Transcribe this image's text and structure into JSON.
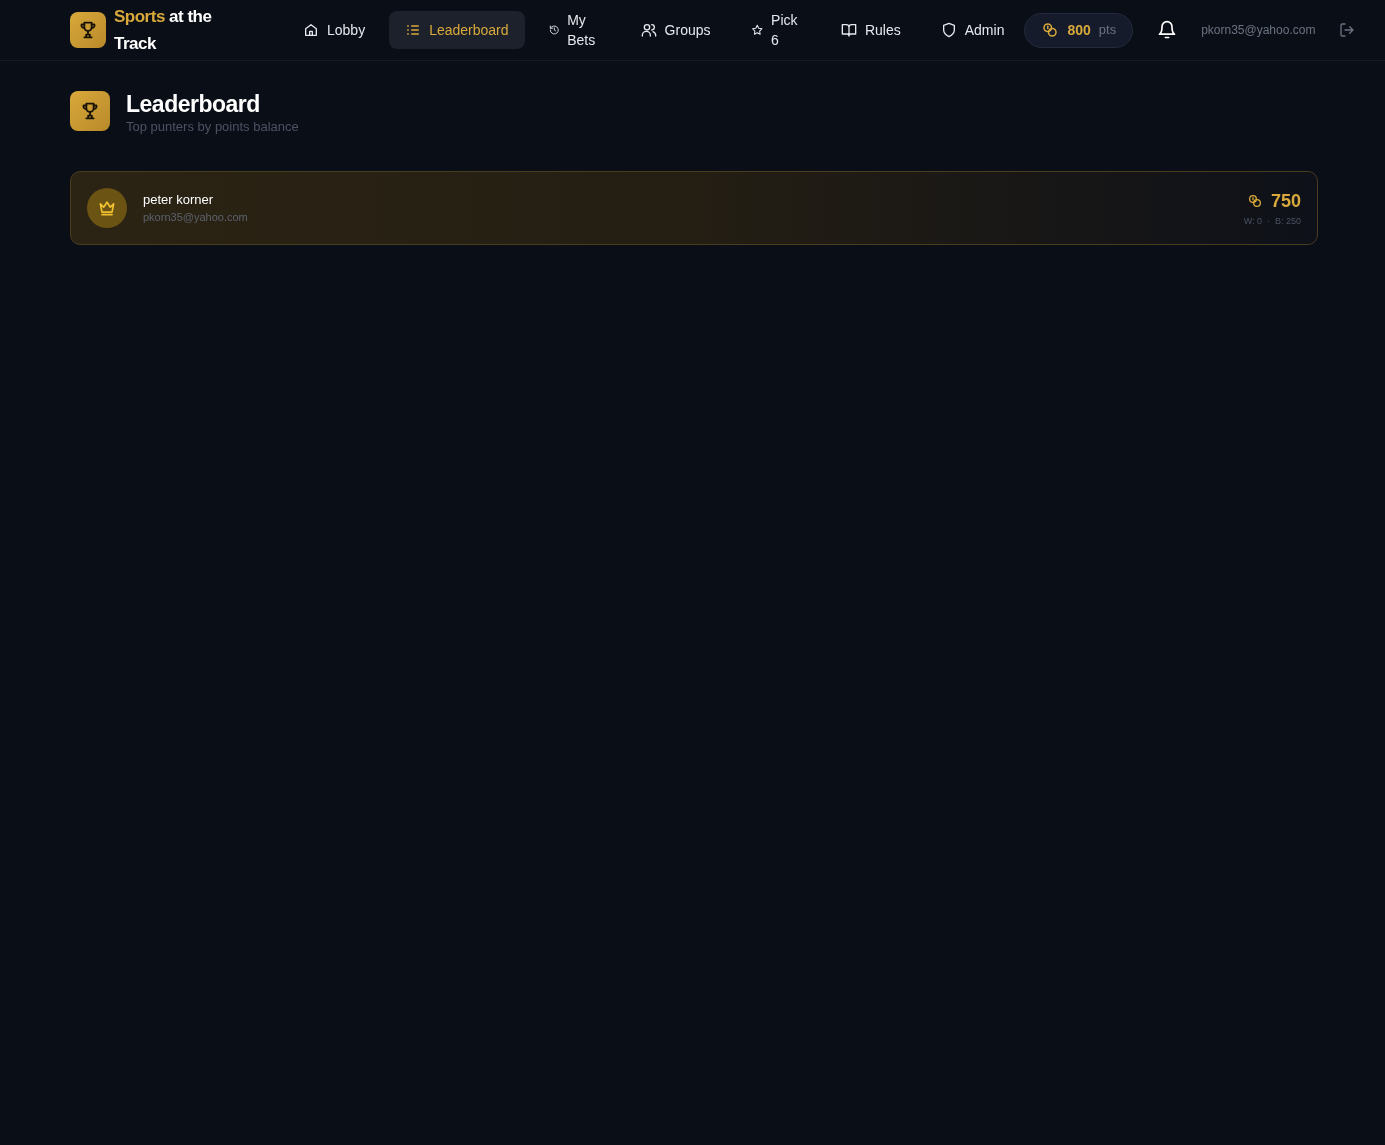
{
  "brand": {
    "accent": "Sports",
    "rest": "at the Track"
  },
  "nav": [
    {
      "label": "Lobby",
      "selected": false
    },
    {
      "label": "Leaderboard",
      "selected": true
    },
    {
      "label": "My Bets",
      "selected": false
    },
    {
      "label": "Groups",
      "selected": false
    },
    {
      "label": "Pick 6",
      "selected": false
    },
    {
      "label": "Rules",
      "selected": false
    },
    {
      "label": "Admin",
      "selected": false
    }
  ],
  "points": {
    "value": "800",
    "unit": "pts"
  },
  "user_email": "pkorn35@yahoo.com",
  "page": {
    "title": "Leaderboard",
    "subtitle": "Top punters by points balance"
  },
  "entries": [
    {
      "name": "peter korner",
      "email": "pkorn35@yahoo.com",
      "points": "750",
      "stats": "W: 0  ·  B: 250"
    }
  ]
}
